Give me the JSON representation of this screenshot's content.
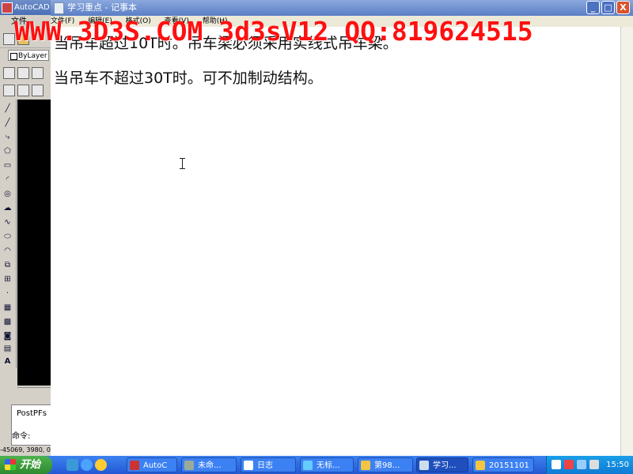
{
  "autocad": {
    "title": "AutoCAD",
    "menu_label": "文件",
    "layer_value": "ByLayer",
    "command_history": "PostPFs",
    "command_prompt": "命令:",
    "coords": "-45069, 3980, 0"
  },
  "notepad": {
    "title": "学习重点 - 记事本",
    "menu": [
      "文件(F)",
      "编辑(E)",
      "格式(O)",
      "查看(V)",
      "帮助(H)"
    ],
    "lines": [
      "当吊车超过10T时。吊车梁必须采用实线式吊车梁。",
      "当吊车不超过30T时。可不加制动结构。"
    ],
    "minimize": "_",
    "maximize": "□",
    "close": "X"
  },
  "watermark": "WWW.3D3S.COM 3d3sV12 QQ:819624515",
  "taskbar": {
    "start_label": "开始",
    "tasks": [
      {
        "label": "AutoC",
        "icon": "autocad-icon"
      },
      {
        "label": "未命...",
        "icon": "recycle-icon"
      },
      {
        "label": "日志",
        "icon": "window-icon"
      },
      {
        "label": "无标...",
        "icon": "paint-icon"
      },
      {
        "label": "第98...",
        "icon": "folder-icon"
      },
      {
        "label": "学习...",
        "icon": "notepad-icon"
      },
      {
        "label": "20151101",
        "icon": "folder-icon"
      }
    ],
    "clock": "15:50"
  },
  "colors": {
    "watermark": "#ff1010",
    "taskbar": "#2358d4",
    "start": "#2e8a2e"
  }
}
